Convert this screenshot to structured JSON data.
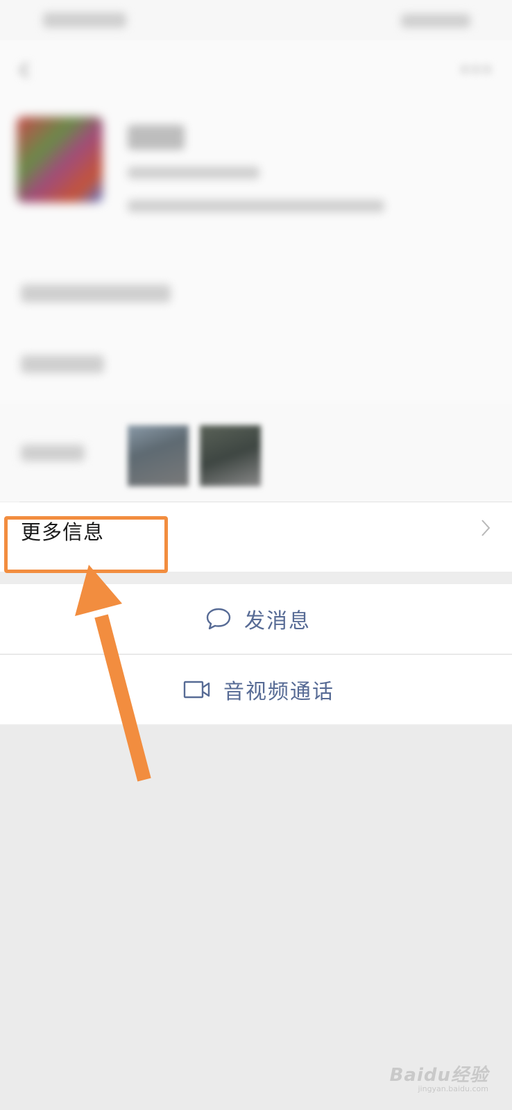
{
  "more_info": {
    "label": "更多信息"
  },
  "actions": [
    {
      "label": "发消息",
      "icon": "chat-bubble-icon"
    },
    {
      "label": "音视频通话",
      "icon": "video-camera-icon"
    }
  ],
  "watermark": {
    "logo": "Baidu",
    "logo_suffix": "经验",
    "sub": "jingyan.baidu.com"
  },
  "colors": {
    "annotation": "#f28d3f",
    "link_text": "#576b95"
  }
}
